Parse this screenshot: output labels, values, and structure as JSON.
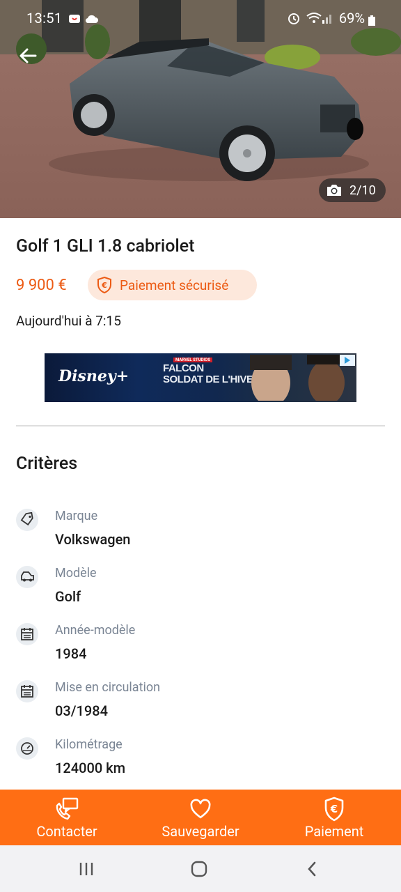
{
  "status_bar": {
    "time": "13:51",
    "battery": "69%"
  },
  "gallery": {
    "photo_counter": "2/10"
  },
  "listing": {
    "title": "Golf 1 GLI 1.8 cabriolet",
    "price": "9 900 €",
    "secure_payment": "Paiement sécurisé",
    "date": "Aujourd'hui à 7:15"
  },
  "ad": {
    "brand": "Disney+",
    "badge": "MARVEL STUDIOS",
    "title_line1": "FALCON",
    "title_line2": "SOLDAT DE L'HIVER"
  },
  "criteria": {
    "title": "Critères",
    "items": [
      {
        "label": "Marque",
        "value": "Volkswagen",
        "icon": "tag-icon"
      },
      {
        "label": "Modèle",
        "value": "Golf",
        "icon": "car-icon"
      },
      {
        "label": "Année-modèle",
        "value": "1984",
        "icon": "calendar-icon"
      },
      {
        "label": "Mise en circulation",
        "value": "03/1984",
        "icon": "calendar-icon"
      },
      {
        "label": "Kilométrage",
        "value": "124000 km",
        "icon": "speedometer-icon"
      }
    ]
  },
  "actions": {
    "contact": "Contacter",
    "save": "Sauvegarder",
    "payment": "Paiement"
  },
  "colors": {
    "accent": "#ff6e14",
    "price": "#ec5a13",
    "pill_bg": "#fde8dc"
  }
}
